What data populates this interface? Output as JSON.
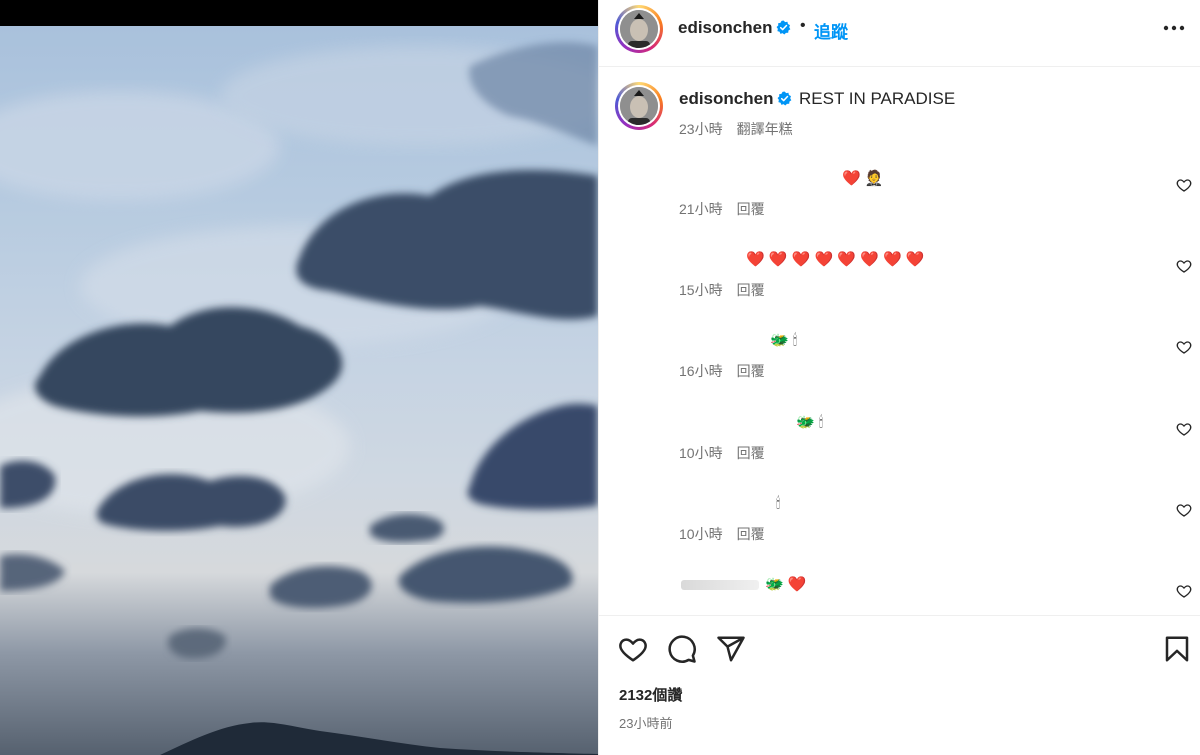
{
  "post": {
    "username": "edisonchen",
    "follow_label": "追蹤",
    "separator": "•",
    "caption": "REST IN PARADISE",
    "caption_time": "23小時",
    "caption_translate": "翻譯年糕",
    "likes": "2132個讚",
    "posted_ago": "23小時前"
  },
  "comments": [
    {
      "emoji": "❤️ 🤵",
      "time": "21小時",
      "reply": "回覆"
    },
    {
      "emoji": "❤️ ❤️ ❤️ ❤️ ❤️ ❤️ ❤️ ❤️",
      "time": "15小時",
      "reply": "回覆"
    },
    {
      "emoji": "🐲 🕯",
      "time": "16小時",
      "reply": "回覆"
    },
    {
      "emoji": "🐲 🕯",
      "time": "10小時",
      "reply": "回覆"
    },
    {
      "emoji": "🕯",
      "time": "10小時",
      "reply": "回覆"
    },
    {
      "emoji": "🐲 ❤️",
      "time": "",
      "reply": ""
    }
  ],
  "colors": {
    "link_blue": "#0095f6",
    "meta_gray": "#737373",
    "text": "#262626",
    "verified_blue": "#0095f6"
  },
  "icons": {
    "verified": "verified-badge-icon",
    "more": "more-options-icon",
    "like": "heart-icon",
    "comment": "comment-bubble-icon",
    "share": "paper-plane-icon",
    "save": "bookmark-icon"
  }
}
